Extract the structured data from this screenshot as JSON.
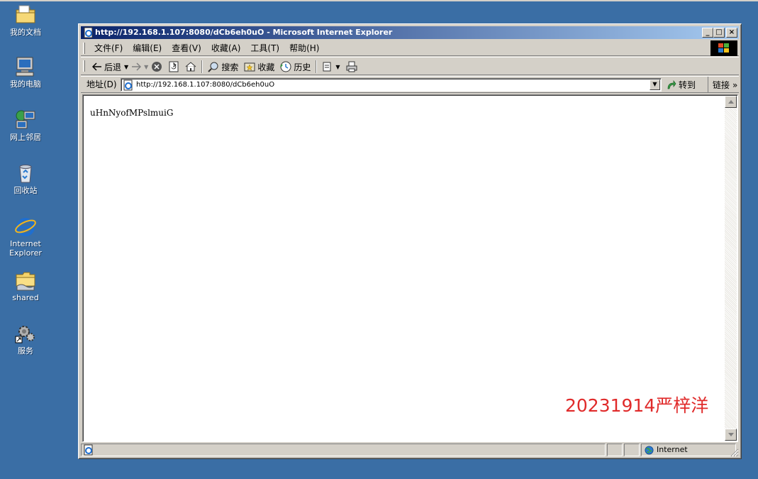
{
  "desktop": {
    "icons": [
      {
        "label": "我的文档"
      },
      {
        "label": "我的电脑"
      },
      {
        "label": "网上邻居"
      },
      {
        "label": "回收站"
      },
      {
        "label": "Internet Explorer"
      },
      {
        "label": "shared"
      },
      {
        "label": "服务"
      }
    ]
  },
  "window": {
    "title": "http://192.168.1.107:8080/dCb6eh0uO - Microsoft Internet Explorer",
    "controls": {
      "minimize": "_",
      "maximize": "□",
      "close": "×"
    }
  },
  "menubar": {
    "items": [
      "文件(F)",
      "编辑(E)",
      "查看(V)",
      "收藏(A)",
      "工具(T)",
      "帮助(H)"
    ]
  },
  "toolbar": {
    "back": "后退",
    "search": "搜索",
    "favorites": "收藏",
    "history": "历史"
  },
  "address": {
    "label": "地址(D)",
    "url": "http://192.168.1.107:8080/dCb6eh0uO",
    "go": "转到",
    "links": "链接",
    "links_more": "»"
  },
  "page": {
    "text": "uHnNyofMPslmuiG",
    "watermark": "20231914严梓洋"
  },
  "status": {
    "zone": "Internet"
  },
  "colors": {
    "desktop": "#3a6ea5",
    "title_start": "#0a246a",
    "title_end": "#a6caf0",
    "watermark": "#e02a2a"
  }
}
